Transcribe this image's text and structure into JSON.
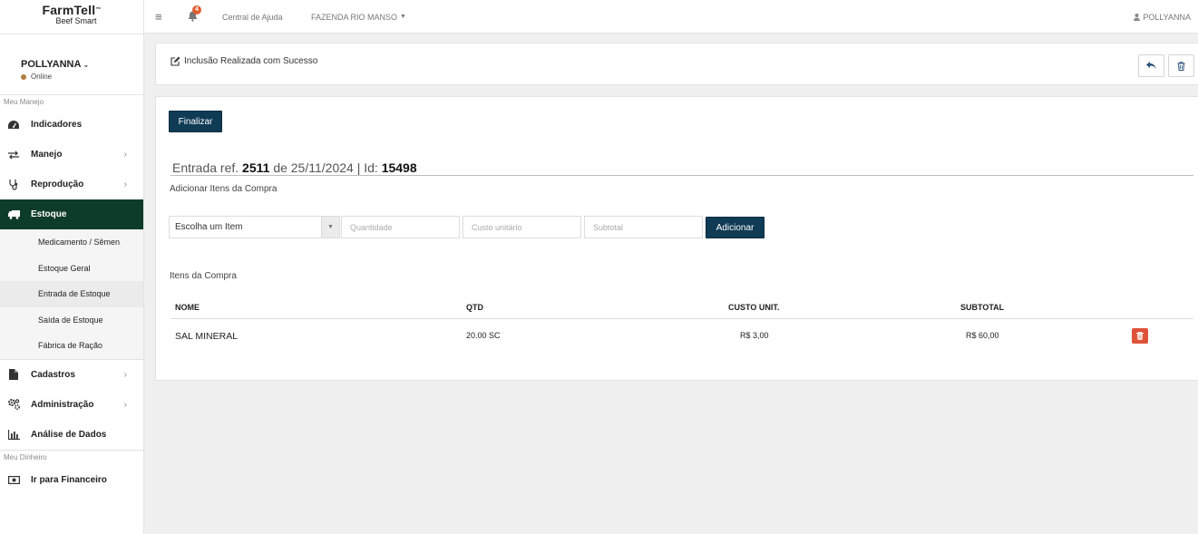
{
  "brand": {
    "name": "FarmTell",
    "tm": "™",
    "subtitle": "Beef Smart"
  },
  "user": {
    "name": "POLLYANNA",
    "status": "Online"
  },
  "sidebar": {
    "section_manejo": "Meu Manejo",
    "items": [
      {
        "label": "Indicadores",
        "icon": "dashboard-icon"
      },
      {
        "label": "Manejo",
        "icon": "exchange-icon"
      },
      {
        "label": "Reprodução",
        "icon": "stethoscope-icon"
      },
      {
        "label": "Estoque",
        "icon": "truck-icon"
      }
    ],
    "estoque_sub": [
      "Medicamento / Sêmen",
      "Estoque Geral",
      "Entrada de Estoque",
      "Saída de Estoque",
      "Fábrica de Ração"
    ],
    "items2": [
      {
        "label": "Cadastros",
        "icon": "file-icon"
      },
      {
        "label": "Administração",
        "icon": "gears-icon"
      },
      {
        "label": "Análise de Dados",
        "icon": "bar-chart-icon"
      }
    ],
    "section_dinheiro": "Meu Dinheiro",
    "financeiro": {
      "label": "Ir para Financeiro",
      "icon": "money-icon"
    }
  },
  "topbar": {
    "notifications": "4",
    "help": "Central de Ajuda",
    "farm": "FAZENDA RIO MANSO",
    "user": "POLLYANNA"
  },
  "message": {
    "text": "Inclusão Realizada com Sucesso"
  },
  "form": {
    "finalize": "Finalizar",
    "entry_prefix": "Entrada ref.",
    "entry_ref": "2511",
    "entry_date": "de 25/11/2024 | Id:",
    "entry_id": "15498",
    "add_items_title": "Adicionar Itens da Compra",
    "select_item": "Escolha um Item",
    "qty_placeholder": "Quantidade",
    "cost_placeholder": "Custo unitário",
    "subtotal_placeholder": "Subtotal",
    "add": "Adicionar"
  },
  "items_table": {
    "title": "Itens da Compra",
    "headers": [
      "NOME",
      "QTD",
      "CUSTO UNIT.",
      "SUBTOTAL"
    ],
    "rows": [
      {
        "nome": "SAL MINERAL",
        "qtd": "20.00 SC",
        "custo": "R$ 3,00",
        "subtotal": "R$ 60,00"
      }
    ]
  }
}
